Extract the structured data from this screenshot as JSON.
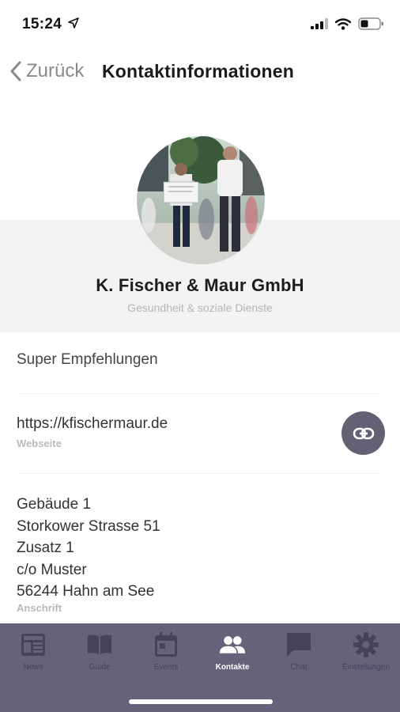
{
  "status_bar": {
    "time": "15:24",
    "icons": [
      "location-arrow-icon",
      "signal-icon",
      "wifi-icon",
      "battery-icon"
    ]
  },
  "header": {
    "back_label": "Zurück",
    "title": "Kontaktinformationen"
  },
  "profile": {
    "name": "K. Fischer & Maur GmbH",
    "category": "Gesundheit & soziale Dienste"
  },
  "tagline": "Super Empfehlungen",
  "website": {
    "url": "https://kfischermaur.de",
    "label": "Webseite",
    "action_icon": "link-icon"
  },
  "address": {
    "lines": [
      "Gebäude 1",
      "Storkower Strasse 51",
      "Zusatz 1",
      "c/o Muster",
      "56244 Hahn am See"
    ],
    "label": "Anschrift"
  },
  "tab_bar": {
    "active": "Kontakte",
    "items": [
      {
        "label": "News",
        "icon": "news-icon"
      },
      {
        "label": "Guide",
        "icon": "book-icon"
      },
      {
        "label": "Events",
        "icon": "calendar-icon"
      },
      {
        "label": "Kontakte",
        "icon": "contacts-icon"
      },
      {
        "label": "Chat",
        "icon": "chat-icon"
      },
      {
        "label": "Einstellungen",
        "icon": "gear-icon"
      }
    ]
  },
  "colors": {
    "tab_bar_bg": "#65627a",
    "tab_inactive": "#45425a",
    "tab_active": "#ffffff",
    "link_button": "#646174"
  }
}
